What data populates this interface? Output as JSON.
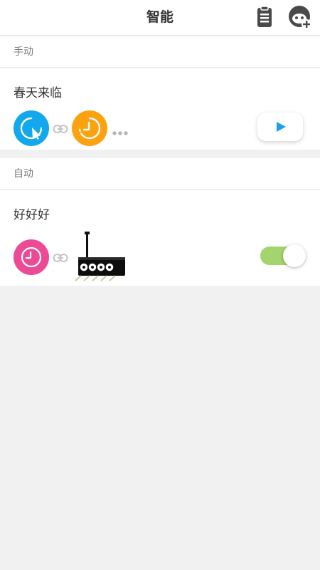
{
  "header": {
    "title": "智能",
    "icons": {
      "log": "clipboard-icon",
      "add": "add-scene-icon"
    }
  },
  "manual": {
    "section_label": "手动",
    "scene": {
      "name": "春天来临",
      "icons": [
        "touch-trigger-icon",
        "link-icon",
        "timer-icon",
        "more-dots-icon",
        "play-icon"
      ],
      "colors": {
        "trigger": "#12a8ee",
        "timer": "#fca20f",
        "play": "#1aa0e8"
      }
    }
  },
  "auto": {
    "section_label": "自动",
    "scene": {
      "name": "好好好",
      "enabled": true,
      "icons": [
        "clock-icon",
        "link-icon",
        "router-device-icon"
      ],
      "colors": {
        "clock": "#ec4a95",
        "toggle": "#a3d46e"
      }
    }
  }
}
